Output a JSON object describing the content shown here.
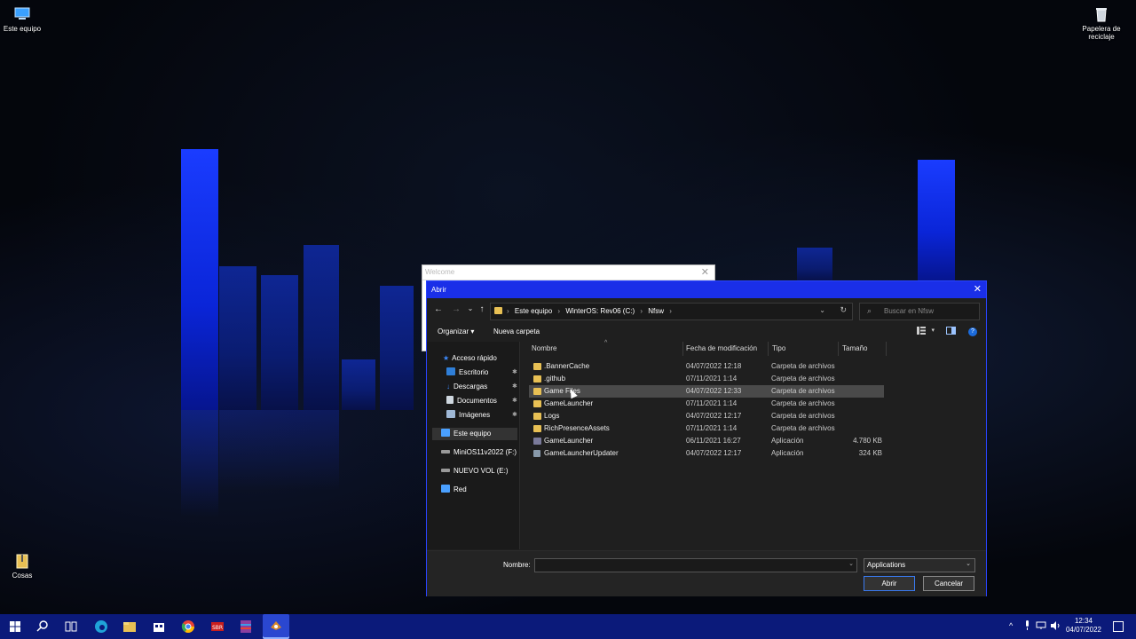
{
  "desktop": {
    "icons": [
      {
        "label": "Este equipo"
      },
      {
        "label": "Papelera de reciclaje"
      },
      {
        "label": "Cosas"
      }
    ]
  },
  "welcome_window": {
    "title": "Welcome",
    "close": "✕"
  },
  "dialog": {
    "title": "Abrir",
    "close": "✕",
    "nav": {
      "back": "←",
      "forward": "→",
      "recent": "⌄",
      "up": "↑"
    },
    "address": {
      "crumbs": [
        "Este equipo",
        "WinterOS: Rev06 (C:)",
        "Nfsw"
      ],
      "separator": "›",
      "dropdown": "⌄",
      "refresh": "↻"
    },
    "search": {
      "icon": "⌕",
      "placeholder": "Buscar en Nfsw"
    },
    "toolbar": {
      "organize": "Organizar ▾",
      "new_folder": "Nueva carpeta",
      "view_arrow": "▾",
      "help": "?"
    },
    "nav_pane": [
      {
        "label": "Acceso rápido",
        "icon": "star-icon",
        "color": "#3d8bff"
      },
      {
        "label": "Escritorio",
        "icon": "desktop-icon",
        "color": "#2f7fd8",
        "pinned": true
      },
      {
        "label": "Descargas",
        "icon": "download-icon",
        "color": "#3d8bff",
        "pinned": true
      },
      {
        "label": "Documentos",
        "icon": "documents-icon",
        "color": "#cfd8e0",
        "pinned": true
      },
      {
        "label": "Imágenes",
        "icon": "images-icon",
        "color": "#9fb8d6",
        "pinned": true
      },
      {
        "label": "Este equipo",
        "icon": "computer-icon",
        "color": "#4aa0ff",
        "selected": true
      },
      {
        "label": "MiniOS11v2022 (F:)",
        "icon": "drive-icon",
        "color": "#cccccc"
      },
      {
        "label": "NUEVO VOL (E:)",
        "icon": "drive-icon",
        "color": "#cccccc"
      },
      {
        "label": "Red",
        "icon": "network-icon",
        "color": "#4aa0ff"
      }
    ],
    "pin_glyph": "📌",
    "columns": {
      "name": "Nombre",
      "date": "Fecha de modificación",
      "type": "Tipo",
      "size": "Tamaño",
      "sort_arrow": "^"
    },
    "files": [
      {
        "name": ".BannerCache",
        "date": "04/07/2022 12:18",
        "type": "Carpeta de archivos",
        "size": "",
        "kind": "folder"
      },
      {
        "name": ".github",
        "date": "07/11/2021 1:14",
        "type": "Carpeta de archivos",
        "size": "",
        "kind": "folder"
      },
      {
        "name": "Game Files",
        "date": "04/07/2022 12:33",
        "type": "Carpeta de archivos",
        "size": "",
        "kind": "folder",
        "selected": true
      },
      {
        "name": "GameLauncher",
        "date": "07/11/2021 1:14",
        "type": "Carpeta de archivos",
        "size": "",
        "kind": "folder"
      },
      {
        "name": "Logs",
        "date": "04/07/2022 12:17",
        "type": "Carpeta de archivos",
        "size": "",
        "kind": "folder"
      },
      {
        "name": "RichPresenceAssets",
        "date": "07/11/2021 1:14",
        "type": "Carpeta de archivos",
        "size": "",
        "kind": "folder"
      },
      {
        "name": "GameLauncher",
        "date": "06/11/2021 16:27",
        "type": "Aplicación",
        "size": "4.780 KB",
        "kind": "app"
      },
      {
        "name": "GameLauncherUpdater",
        "date": "04/07/2022 12:17",
        "type": "Aplicación",
        "size": "324 KB",
        "kind": "app2"
      }
    ],
    "filename_label": "Nombre:",
    "filename_value": "",
    "filter_value": "Applications",
    "dropdown_glyph": "⌄",
    "open_button": "Abrir",
    "cancel_button": "Cancelar"
  },
  "taskbar": {
    "apps": [
      {
        "name": "start-icon",
        "color": "#ffffff"
      },
      {
        "name": "search-icon",
        "color": "#ffffff"
      },
      {
        "name": "task-view-icon",
        "color": "#ffffff"
      },
      {
        "name": "edge-icon",
        "color": "#1fa3d8"
      },
      {
        "name": "file-explorer-icon",
        "color": "#e8c054"
      },
      {
        "name": "store-icon",
        "color": "#ffffff"
      },
      {
        "name": "chrome-icon",
        "color": "#e94235"
      },
      {
        "name": "sbr-app-icon",
        "color": "#c81e1e"
      },
      {
        "name": "winrar-icon",
        "color": "#8a3fa0"
      },
      {
        "name": "game-launcher-icon",
        "color": "#d98a2a"
      }
    ],
    "tray_symbols": [
      "^",
      "🎙",
      "⌂",
      "🔊"
    ],
    "time": "12:34",
    "date": "04/07/2022"
  }
}
